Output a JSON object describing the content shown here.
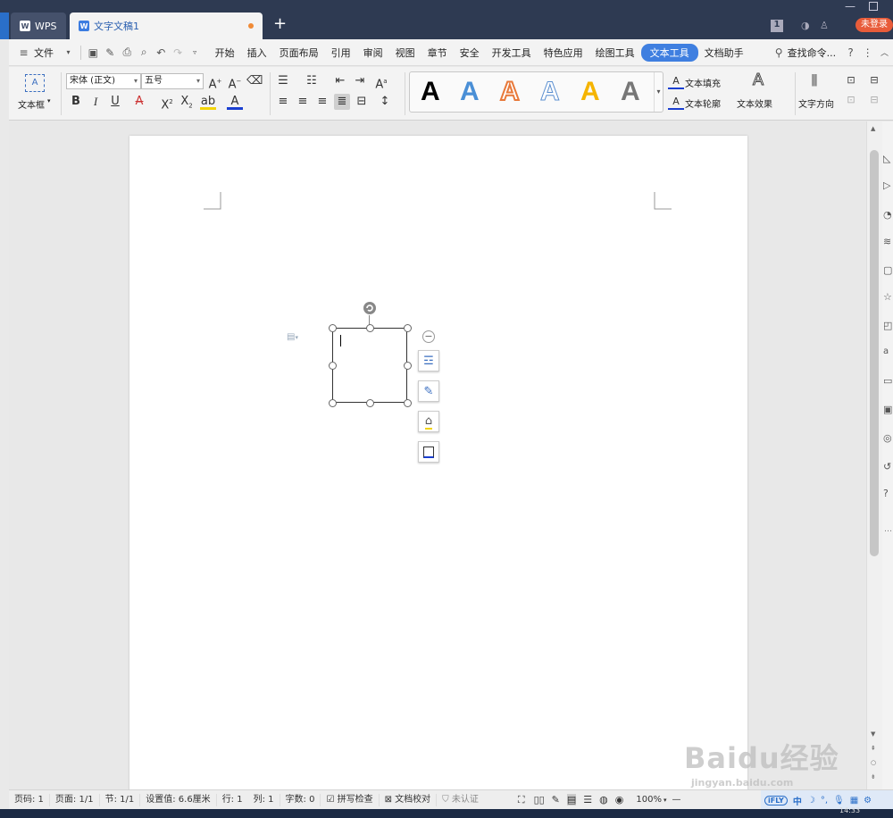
{
  "titlebar": {
    "tabs": [
      {
        "label": "WPS",
        "icon": "wps-logo-icon"
      },
      {
        "label": "文字文稿1",
        "icon": "writer-doc-icon",
        "modified": true
      }
    ],
    "new_tab": "+",
    "page_indicator": "1",
    "login": "未登录",
    "colors": {
      "bg": "#2e3a52",
      "login": "#e85c3a",
      "accent": "#3f7fe0"
    }
  },
  "menubar": {
    "file": "文件",
    "items": [
      "开始",
      "插入",
      "页面布局",
      "引用",
      "审阅",
      "视图",
      "章节",
      "安全",
      "开发工具",
      "特色应用",
      "绘图工具",
      "文本工具",
      "文档助手"
    ],
    "active": "文本工具",
    "search": "查找命令..."
  },
  "ribbon": {
    "textbox_label": "文本框",
    "font_name": "宋体 (正文)",
    "font_size": "五号",
    "text_fill": "文本填充",
    "text_outline": "文本轮廓",
    "text_effect": "文本效果",
    "text_direction": "文字方向",
    "style_glyph": "A"
  },
  "statusbar": {
    "page_code": "页码: 1",
    "pages": "页面: 1/1",
    "section": "节: 1/1",
    "setting": "设置值: 6.6厘米",
    "row": "行: 1",
    "col": "列: 1",
    "word_count": "字数: 0",
    "spell_check": "拼写检查",
    "doc_proof": "文档校对",
    "uncertified": "未认证",
    "zoom": "100%",
    "minus": "—",
    "ifly": "iFLY",
    "zh": "中"
  },
  "taskbar": {
    "time": "14:33"
  },
  "watermark": {
    "text": "Baidu经验",
    "sub": "jingyan.baidu.com"
  }
}
